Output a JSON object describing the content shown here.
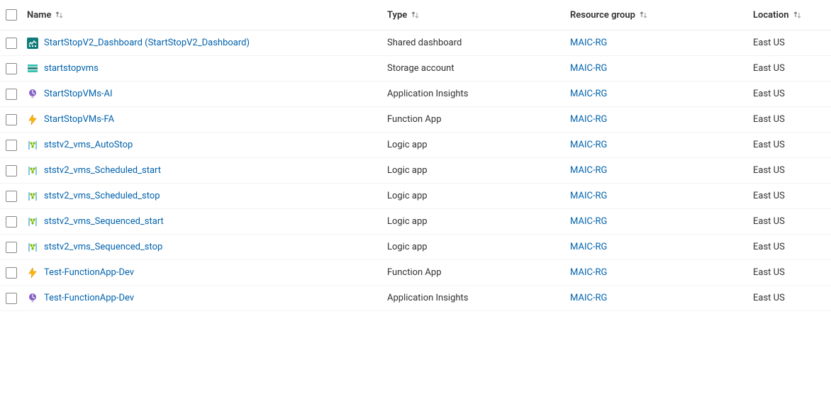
{
  "columns": {
    "name": "Name",
    "type": "Type",
    "resource_group": "Resource group",
    "location": "Location"
  },
  "rows": [
    {
      "name": "StartStopV2_Dashboard (StartStopV2_Dashboard)",
      "type": "Shared dashboard",
      "resource_group": "MAIC-RG",
      "location": "East US",
      "icon": "dashboard"
    },
    {
      "name": "startstopvms",
      "type": "Storage account",
      "resource_group": "MAIC-RG",
      "location": "East US",
      "icon": "storage"
    },
    {
      "name": "StartStopVMs-AI",
      "type": "Application Insights",
      "resource_group": "MAIC-RG",
      "location": "East US",
      "icon": "appinsights"
    },
    {
      "name": "StartStopVMs-FA",
      "type": "Function App",
      "resource_group": "MAIC-RG",
      "location": "East US",
      "icon": "function"
    },
    {
      "name": "ststv2_vms_AutoStop",
      "type": "Logic app",
      "resource_group": "MAIC-RG",
      "location": "East US",
      "icon": "logicapp"
    },
    {
      "name": "ststv2_vms_Scheduled_start",
      "type": "Logic app",
      "resource_group": "MAIC-RG",
      "location": "East US",
      "icon": "logicapp"
    },
    {
      "name": "ststv2_vms_Scheduled_stop",
      "type": "Logic app",
      "resource_group": "MAIC-RG",
      "location": "East US",
      "icon": "logicapp"
    },
    {
      "name": "ststv2_vms_Sequenced_start",
      "type": "Logic app",
      "resource_group": "MAIC-RG",
      "location": "East US",
      "icon": "logicapp"
    },
    {
      "name": "ststv2_vms_Sequenced_stop",
      "type": "Logic app",
      "resource_group": "MAIC-RG",
      "location": "East US",
      "icon": "logicapp"
    },
    {
      "name": "Test-FunctionApp-Dev",
      "type": "Function App",
      "resource_group": "MAIC-RG",
      "location": "East US",
      "icon": "function"
    },
    {
      "name": "Test-FunctionApp-Dev",
      "type": "Application Insights",
      "resource_group": "MAIC-RG",
      "location": "East US",
      "icon": "appinsights"
    }
  ]
}
